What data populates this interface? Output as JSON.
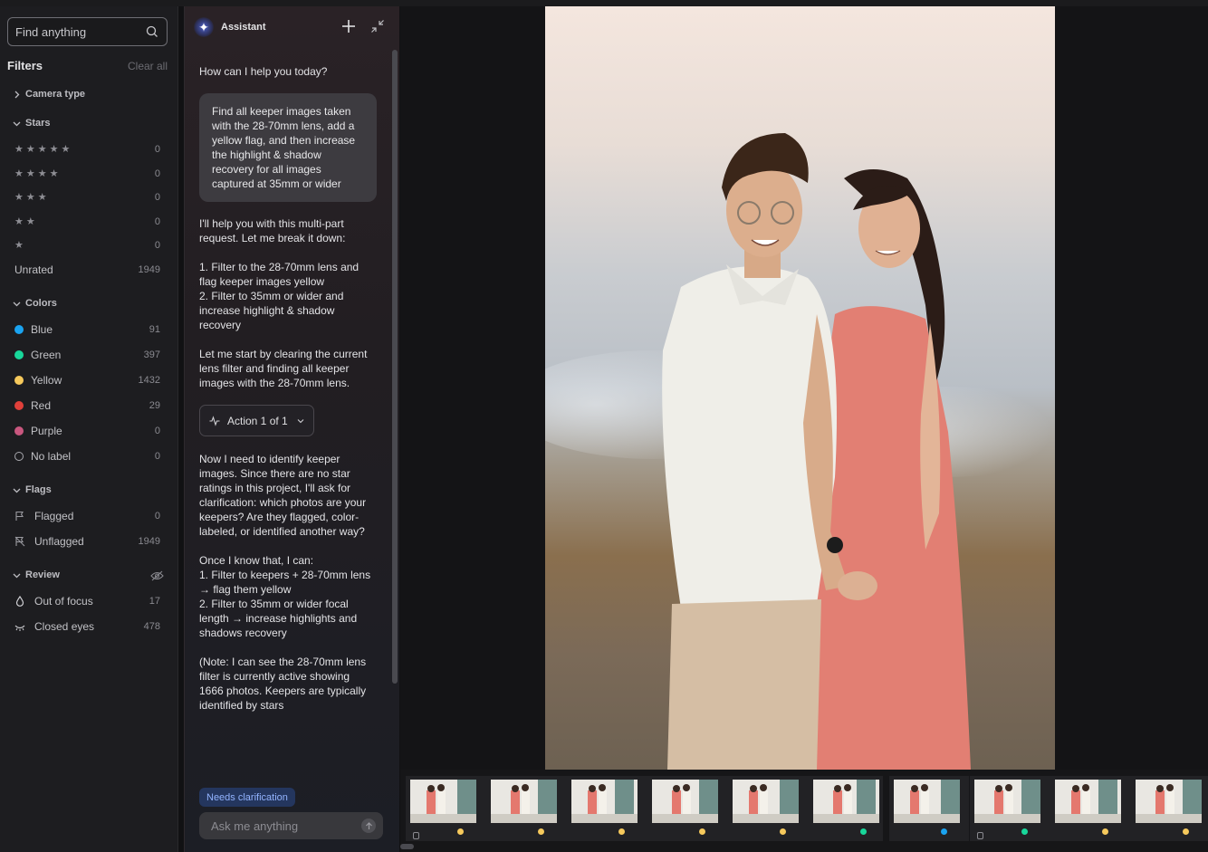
{
  "sidebar": {
    "search": {
      "placeholder": "Find anything"
    },
    "filters_title": "Filters",
    "clear_all": "Clear all",
    "camera_type": "Camera type",
    "stars_section": "Stars",
    "stars": [
      {
        "stars": 5,
        "count": "0"
      },
      {
        "stars": 4,
        "count": "0"
      },
      {
        "stars": 3,
        "count": "0"
      },
      {
        "stars": 2,
        "count": "0"
      },
      {
        "stars": 1,
        "count": "0"
      }
    ],
    "unrated": {
      "label": "Unrated",
      "count": "1949"
    },
    "colors_section": "Colors",
    "colors": [
      {
        "label": "Blue",
        "count": "91",
        "color": "#1aa3f0"
      },
      {
        "label": "Green",
        "count": "397",
        "color": "#18d79a"
      },
      {
        "label": "Yellow",
        "count": "1432",
        "color": "#f6c95c"
      },
      {
        "label": "Red",
        "count": "29",
        "color": "#e0403a"
      },
      {
        "label": "Purple",
        "count": "0",
        "color": "#c9577f"
      },
      {
        "label": "No label",
        "count": "0",
        "color": "none"
      }
    ],
    "flags_section": "Flags",
    "flags": [
      {
        "label": "Flagged",
        "count": "0",
        "icon": "flag-icon"
      },
      {
        "label": "Unflagged",
        "count": "1949",
        "icon": "flag-off-icon"
      }
    ],
    "review_section": "Review",
    "review": [
      {
        "label": "Out of focus",
        "count": "17",
        "icon": "focus-drop-icon"
      },
      {
        "label": "Closed eyes",
        "count": "478",
        "icon": "closed-eye-icon"
      }
    ]
  },
  "assistant": {
    "title": "Assistant",
    "greeting": "How can I help you today?",
    "user_message": "Find all keeper images taken with the 28-70mm lens, add a yellow flag, and then increase the highlight & shadow recovery for all images captured at 35mm or wider",
    "reply_1": "I'll help you with this multi-part request. Let me break it down:",
    "reply_2": "1. Filter to the 28-70mm lens and flag keeper images yellow\n2. Filter to 35mm or wider and increase highlight & shadow recovery",
    "reply_3": "Let me start by clearing the current lens filter and finding all keeper images with the 28-70mm lens.",
    "action_label": "Action 1 of 1",
    "reply_4": "Now I need to identify keeper images. Since there are no star ratings in this project, I'll ask for clarification: which photos are your keepers? Are they flagged, color-labeled, or identified another way?",
    "reply_5": "Once I know that, I can:\n1. Filter to keepers + 28-70mm lens → flag them yellow\n2. Filter to 35mm or wider focal length → increase highlights and shadows recovery",
    "reply_6": "(Note: I can see the 28-70mm lens filter is currently active showing 1666 photos. Keepers are typically identified by stars",
    "status_badge": "Needs clarification",
    "input_placeholder": "Ask me anything"
  },
  "filmstrip": {
    "thumbs": [
      {
        "dot": "#f6c95c",
        "badge": true
      },
      {
        "dot": "#f6c95c",
        "badge": false
      },
      {
        "dot": "#f6c95c",
        "badge": false
      },
      {
        "dot": "#f6c95c",
        "badge": false
      },
      {
        "dot": "#f6c95c",
        "badge": false
      },
      {
        "dot": "#18d79a",
        "badge": false
      },
      {
        "dot": "#1aa3f0",
        "badge": false
      },
      {
        "dot": "#18d79a",
        "badge": true
      },
      {
        "dot": "#f6c95c",
        "badge": false
      },
      {
        "dot": "#f6c95c",
        "badge": false
      }
    ]
  }
}
